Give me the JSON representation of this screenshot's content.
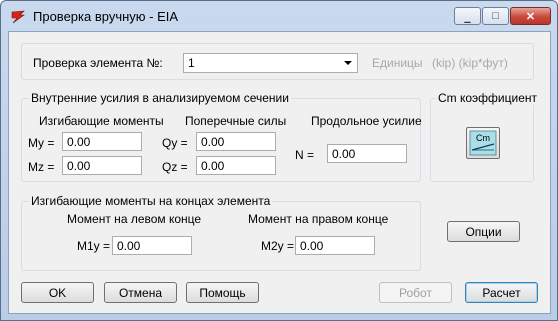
{
  "window": {
    "title": "Проверка вручную - EIA",
    "minimize": "▁",
    "maximize": "□",
    "close": "✕",
    "app_icon": "eia-app-icon"
  },
  "top": {
    "element_label": "Проверка элемента №:",
    "element_value": "1",
    "units_label": "Единицы",
    "units_value": "(kip) (kip*фут)"
  },
  "forces": {
    "legend": "Внутренние усилия в анализируемом сечении",
    "bending_heading": "Изгибающие моменты",
    "shear_heading": "Поперечные силы",
    "axial_heading": "Продольное усилие",
    "my_label": "My =",
    "my_value": "0.00",
    "mz_label": "Mz =",
    "mz_value": "0.00",
    "qy_label": "Qy =",
    "qy_value": "0.00",
    "qz_label": "Qz =",
    "qz_value": "0.00",
    "n_label": "N =",
    "n_value": "0.00"
  },
  "cm": {
    "legend": "Cm коэффициент",
    "button_icon": "cm-coefficient-icon",
    "button_text": "Cm"
  },
  "end_moments": {
    "legend": "Изгибающие моменты на концах элемента",
    "left_heading": "Момент на левом конце",
    "right_heading": "Момент на правом конце",
    "m1y_label": "M1y =",
    "m1y_value": "0.00",
    "m2y_label": "M2y =",
    "m2y_value": "0.00"
  },
  "buttons": {
    "options": "Опции",
    "ok": "OK",
    "cancel": "Отмена",
    "help": "Помощь",
    "robot": "Робот",
    "calculate": "Расчет"
  },
  "colors": {
    "title_gradient_top": "#c9d9ee",
    "client_bg": "#f0f0f0",
    "close_button": "#c9483a",
    "disabled_text": "#a8a8a8"
  }
}
